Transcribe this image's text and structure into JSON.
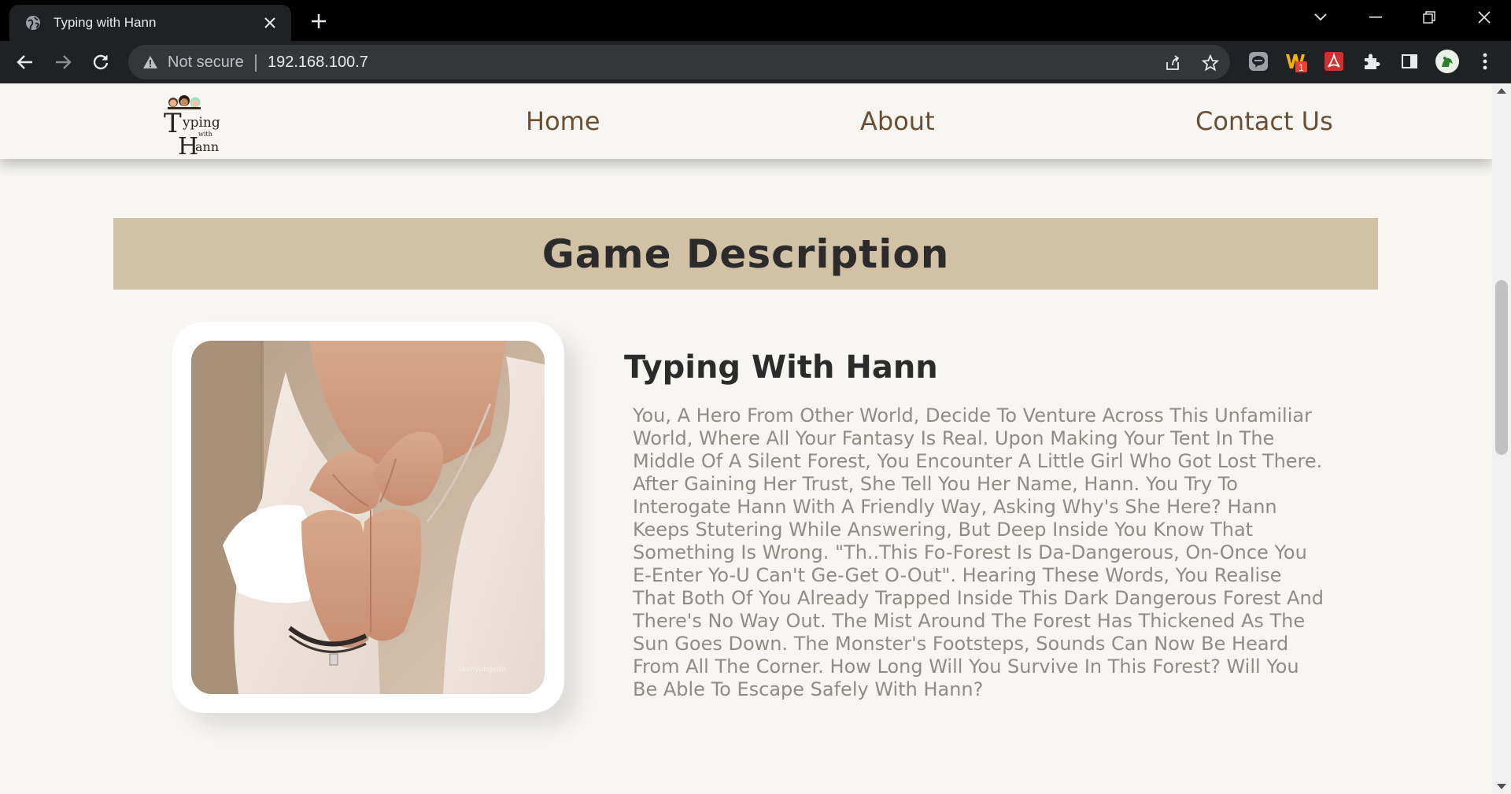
{
  "browser": {
    "tab_title": "Typing with Hann",
    "address_security": "Not secure",
    "address_url": "192.168.100.7",
    "extension_badge": "1"
  },
  "site": {
    "logo": {
      "big_letter_t": "T",
      "word_yping": "yping",
      "word_with": "with",
      "big_letter_h": "H",
      "word_ann": "ann"
    },
    "nav": {
      "home": "Home",
      "about": "About",
      "contact": "Contact Us"
    }
  },
  "main": {
    "section_title": "Game Description",
    "game_title": "Typing With Hann",
    "description": "You, A Hero From Other World, Decide To Venture Across This Unfamiliar World, Where All Your Fantasy Is Real. Upon Making Your Tent In The Middle Of A Silent Forest, You Encounter A Little Girl Who Got Lost There. After Gaining Her Trust, She Tell You Her Name, Hann. You Try To Interogate Hann With A Friendly Way, Asking Why's She Here? Hann Keeps Stutering While Answering, But Deep Inside You Know That Something Is Wrong. \"Th..This Fo-Forest Is Da-Dangerous, On-Once You E-Enter Yo-U Can't Ge-Get O-Out\". Hearing These Words, You Realise That Both Of You Already Trapped Inside This Dark Dangerous Forest And There's No Way Out. The Mist Around The Forest Has Thickened As The Sun Goes Down. The Monster's Footsteps, Sounds Can Now Be Heard From All The Corner. How Long Will You Survive In This Forest? Will You Be Able To Escape Safely With Hann?",
    "photo_watermark": "taehyungedit"
  },
  "colors": {
    "page_bg": "#f7f6f2",
    "nav_text": "#6b4f33",
    "banner_bg": "#d1c1a5",
    "heading_text": "#2b2b2b",
    "body_text": "#8e8c86"
  },
  "icons": {
    "tab_favicon": "globe-icon",
    "tab_close": "close-icon",
    "new_tab": "plus-icon",
    "back": "arrow-left-icon",
    "forward": "arrow-right-icon",
    "reload": "reload-icon",
    "warning": "warning-icon",
    "share": "share-icon",
    "bookmark": "star-icon",
    "extensions": [
      "chat-extension-icon",
      "office-extension-icon",
      "pdf-extension-icon",
      "puzzle-icon",
      "side-panel-icon",
      "profile-avatar-icon",
      "kebab-menu-icon"
    ]
  }
}
